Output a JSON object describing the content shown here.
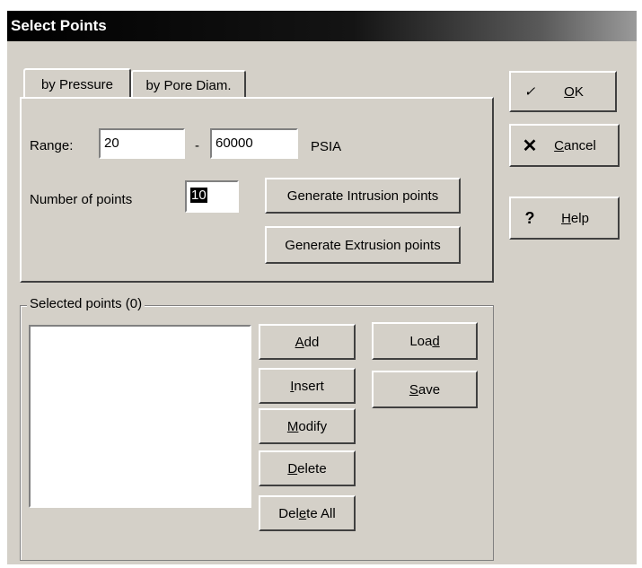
{
  "window": {
    "title": "Select Points"
  },
  "tabs": [
    {
      "label": "by Pressure"
    },
    {
      "label": "by Pore Diam."
    }
  ],
  "range": {
    "label": "Range:",
    "min_value": "20",
    "separator": "-",
    "max_value": "60000",
    "unit": "PSIA"
  },
  "num_points": {
    "label": "Number of points",
    "value": "10"
  },
  "generate": {
    "intrusion_label": "Generate Intrusion points",
    "extrusion_label": "Generate Extrusion points"
  },
  "selected": {
    "title": "Selected points (0)",
    "items": []
  },
  "list_buttons": {
    "add": {
      "pre": "",
      "key": "A",
      "post": "dd"
    },
    "insert": {
      "pre": "",
      "key": "I",
      "post": "nsert"
    },
    "modify": {
      "pre": "",
      "key": "M",
      "post": "odify"
    },
    "delete": {
      "pre": "",
      "key": "D",
      "post": "elete"
    },
    "delete_all": {
      "pre": "Del",
      "key": "e",
      "post": "te All"
    },
    "load": {
      "pre": "Loa",
      "key": "d",
      "post": ""
    },
    "save": {
      "pre": "",
      "key": "S",
      "post": "ave"
    }
  },
  "side_buttons": {
    "ok": {
      "pre": "",
      "key": "O",
      "post": "K",
      "icon": "check-icon",
      "glyph": "✓"
    },
    "cancel": {
      "pre": "",
      "key": "C",
      "post": "ancel",
      "icon": "x-icon",
      "glyph": "✕"
    },
    "help": {
      "pre": "",
      "key": "H",
      "post": "elp",
      "icon": "question-icon",
      "glyph": "?"
    }
  }
}
